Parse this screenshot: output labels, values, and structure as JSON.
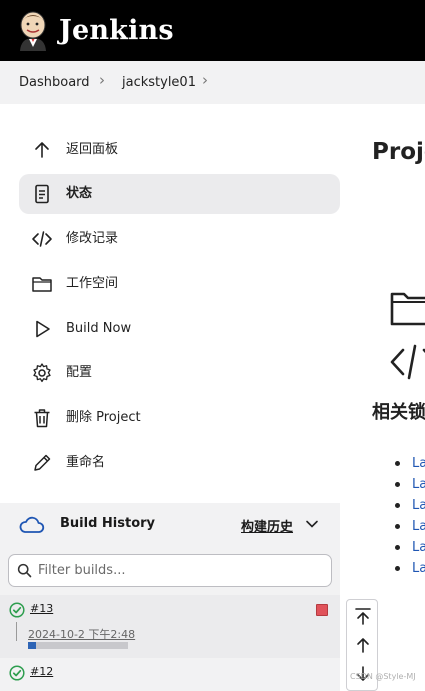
{
  "header": {
    "brand": "Jenkins"
  },
  "breadcrumb": {
    "items": [
      "Dashboard",
      "jackstyle01"
    ]
  },
  "sidebar": {
    "items": [
      {
        "label": "返回面板",
        "icon": "arrow-up-icon"
      },
      {
        "label": "状态",
        "icon": "document-icon",
        "active": true
      },
      {
        "label": "修改记录",
        "icon": "code-icon"
      },
      {
        "label": "工作空间",
        "icon": "folder-icon"
      },
      {
        "label": "Build Now",
        "icon": "play-icon"
      },
      {
        "label": "配置",
        "icon": "gear-icon"
      },
      {
        "label": "删除 Project",
        "icon": "trash-icon"
      },
      {
        "label": "重命名",
        "icon": "pencil-icon"
      }
    ]
  },
  "build_history": {
    "title": "Build History",
    "trend_label": "构建历史",
    "filter_placeholder": "Filter builds...",
    "builds": [
      {
        "number": "#13",
        "date": "2024-10-2 下午2:48",
        "status": "success",
        "progress": 0.08
      },
      {
        "number": "#12",
        "status": "success"
      }
    ]
  },
  "main": {
    "title": "Proje",
    "related_title": "相关锁",
    "links": [
      "La",
      "La",
      "La",
      "La",
      "La",
      "La"
    ]
  },
  "watermark": "CSDN @Style-MJ",
  "colors": {
    "topbar": "#000000",
    "link": "#1f56b3",
    "success": "#2e9e4f",
    "progress": "#2e64b5",
    "delete": "#e0525a"
  }
}
